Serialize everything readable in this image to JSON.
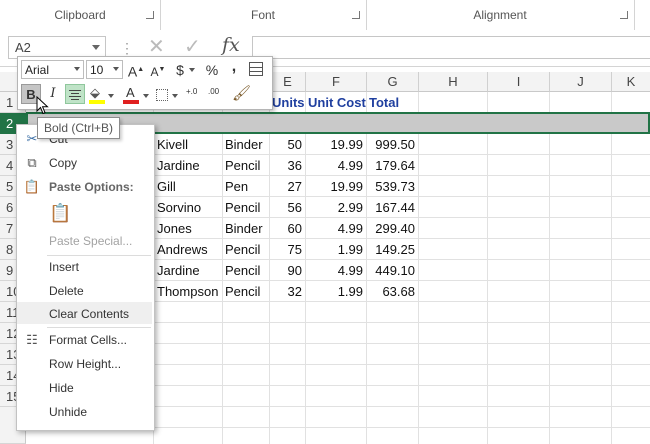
{
  "ribbon": {
    "groups": [
      {
        "label": "Clipboard"
      },
      {
        "label": "Font"
      },
      {
        "label": "Alignment"
      }
    ]
  },
  "formula_bar": {
    "name_box": "A2",
    "cancel_icon": "✕",
    "enter_icon": "✓",
    "fx_label": "fx"
  },
  "mini_toolbar": {
    "font_name": "Arial",
    "font_size": "10",
    "grow_font": "A",
    "shrink_font": "A",
    "currency": "$",
    "percent": "%",
    "comma": ",",
    "bold": "B",
    "italic": "I",
    "font_color_letter": "A",
    "decrease_decimal": ".00",
    "increase_decimal": "+.0"
  },
  "tooltip": "Bold (Ctrl+B)",
  "grid": {
    "columns": [
      "E",
      "F",
      "G",
      "H",
      "I",
      "J",
      "K"
    ],
    "rows": [
      "1",
      "2",
      "3",
      "4",
      "5",
      "6",
      "7",
      "8",
      "9",
      "10",
      "11",
      "12",
      "13",
      "14",
      "15"
    ],
    "header_row": {
      "units": "Units",
      "unit_cost": "Unit Cost",
      "total": "Total"
    },
    "data": [
      {
        "rep": "Kivell",
        "item": "Binder",
        "units": "50",
        "cost": "19.99",
        "total": "999.50"
      },
      {
        "rep": "Jardine",
        "item": "Pencil",
        "units": "36",
        "cost": "4.99",
        "total": "179.64"
      },
      {
        "rep": "Gill",
        "item": "Pen",
        "units": "27",
        "cost": "19.99",
        "total": "539.73"
      },
      {
        "rep": "Sorvino",
        "item": "Pencil",
        "units": "56",
        "cost": "2.99",
        "total": "167.44"
      },
      {
        "rep": "Jones",
        "item": "Binder",
        "units": "60",
        "cost": "4.99",
        "total": "299.40"
      },
      {
        "rep": "Andrews",
        "item": "Pencil",
        "units": "75",
        "cost": "1.99",
        "total": "149.25"
      },
      {
        "rep": "Jardine",
        "item": "Pencil",
        "units": "90",
        "cost": "4.99",
        "total": "449.10"
      },
      {
        "rep": "Thompson",
        "item": "Pencil",
        "units": "32",
        "cost": "1.99",
        "total": "63.68"
      }
    ]
  },
  "context_menu": {
    "cut": "Cut",
    "copy": "Copy",
    "paste_options": "Paste Options:",
    "paste_special": "Paste Special...",
    "insert": "Insert",
    "delete": "Delete",
    "clear_contents": "Clear Contents",
    "format_cells": "Format Cells...",
    "row_height": "Row Height...",
    "hide": "Hide",
    "unhide": "Unhide"
  },
  "colors": {
    "excel_green": "#217346",
    "header_text_blue": "#1f3f9f",
    "font_color_bar": "#e02020",
    "highlight_bar": "#ffff00"
  }
}
